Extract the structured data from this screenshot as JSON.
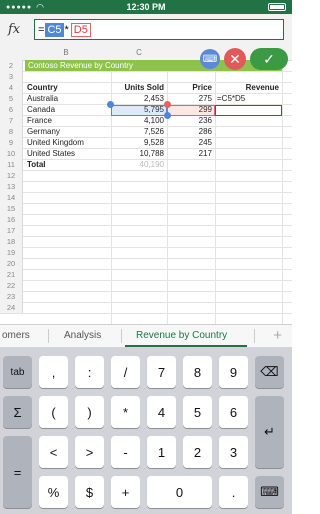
{
  "status": {
    "time": "12:30 PM"
  },
  "formula": {
    "fx": "fx",
    "eq": "=",
    "ref1": "C5",
    "op": "*",
    "ref2": "D5"
  },
  "columns": [
    "B",
    "C"
  ],
  "rows": [
    {
      "n": "2",
      "a": "Contoso Revenue by Country",
      "b": "",
      "c": "",
      "d": ""
    },
    {
      "n": "3",
      "a": "",
      "b": "",
      "c": "",
      "d": ""
    },
    {
      "n": "4",
      "a": "Country",
      "b": "Units Sold",
      "c": "Price",
      "d": "Revenue"
    },
    {
      "n": "5",
      "a": "Australia",
      "b": "2,453",
      "c": "275",
      "d": "=C5*D5"
    },
    {
      "n": "6",
      "a": "Canada",
      "b": "5,795",
      "c": "299",
      "d": ""
    },
    {
      "n": "7",
      "a": "France",
      "b": "4,100",
      "c": "236",
      "d": ""
    },
    {
      "n": "8",
      "a": "Germany",
      "b": "7,526",
      "c": "286",
      "d": ""
    },
    {
      "n": "9",
      "a": "United Kingdom",
      "b": "9,528",
      "c": "245",
      "d": ""
    },
    {
      "n": "10",
      "a": "United States",
      "b": "10,788",
      "c": "217",
      "d": ""
    },
    {
      "n": "11",
      "a": "Total",
      "b": "40,190",
      "c": "",
      "d": ""
    },
    {
      "n": "12"
    },
    {
      "n": "13"
    },
    {
      "n": "14"
    },
    {
      "n": "15"
    },
    {
      "n": "16"
    },
    {
      "n": "17"
    },
    {
      "n": "18"
    },
    {
      "n": "19"
    },
    {
      "n": "20"
    },
    {
      "n": "21"
    },
    {
      "n": "22"
    },
    {
      "n": "23"
    },
    {
      "n": "24"
    }
  ],
  "tabs": [
    "omers",
    "Analysis",
    "Revenue by Country"
  ],
  "tab_add": "+",
  "keyboard": [
    [
      "tab",
      ",",
      ":",
      "/",
      "7",
      "8",
      "9",
      "⌫"
    ],
    [
      "Σ",
      "(",
      ")",
      "*",
      "4",
      "5",
      "6",
      "↵"
    ],
    [
      "=",
      "<",
      ">",
      "-",
      "1",
      "2",
      "3"
    ],
    [
      "%",
      "$",
      "+",
      "0",
      ".",
      "⌨"
    ]
  ],
  "colors": {
    "excel_green": "#217346",
    "title_fill": "#8cc34a",
    "ref_blue": "#4f86d6",
    "ref_red": "#e06666"
  }
}
